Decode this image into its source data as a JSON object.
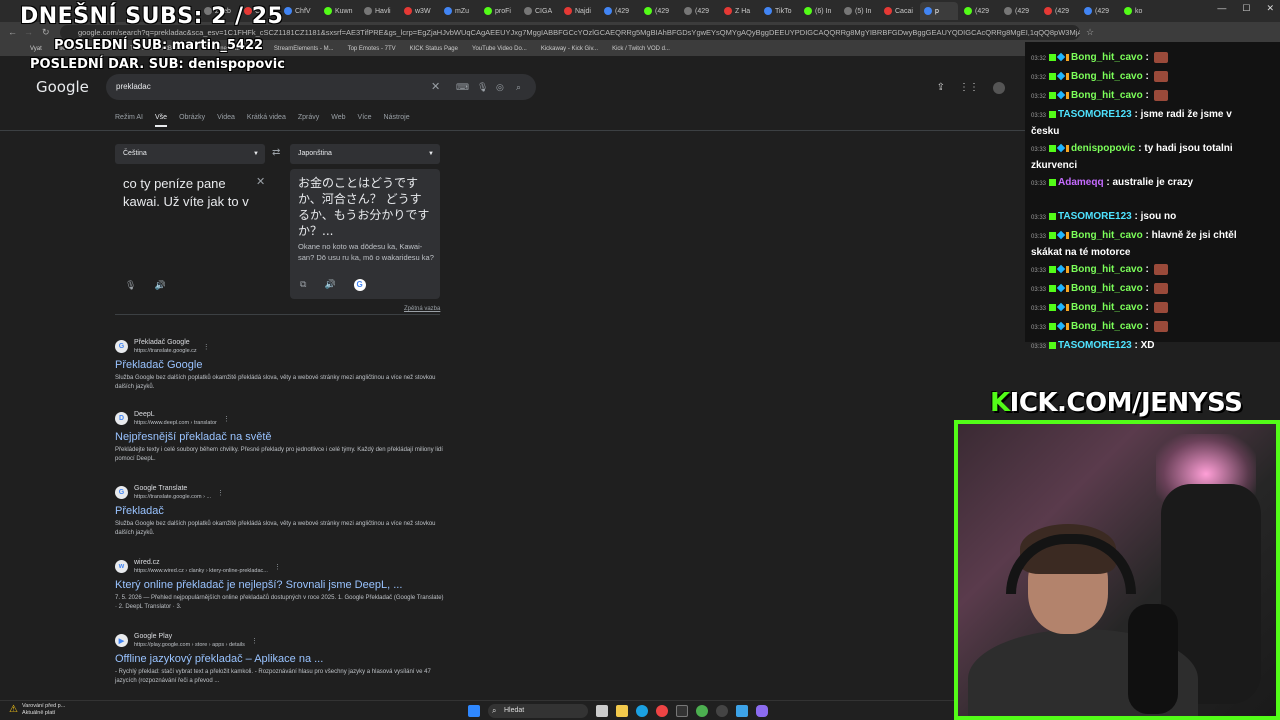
{
  "browser": {
    "tabs": [
      "Zoeb",
      "Čtv",
      "ChfV",
      "Kuwn",
      "Havli",
      "w3W",
      "mZu",
      "proFi",
      "CIGA",
      "Najdi",
      "(429",
      "(429",
      "(429",
      "Z Ha",
      "TikTo",
      "(6) In",
      "(5) In",
      "Cacai",
      "p",
      "(429",
      "(429",
      "(429",
      "(429",
      "ko"
    ],
    "active_tab_index": 18,
    "url": "google.com/search?q=prekladac&sca_esv=1C1FHFk_cSCZ1181CZ1181&sxsrf=AE3TifPRE&gs_lcrp=EgZjaHJvbWUqCAgAEEUYJxg7MggIABBFGCcYOzlGCAEQRRg5MgBIAhBFGDsYgwEYsQMYgAQyBggDEEUYPDIGCAQQRRg8MgYIBRBFGDwyBggGEAUYQDIGCAcQRRg8MgEI,1qQQ8pW3MjAk&sourceid=chrome&ie=UTF-8",
    "bookmarks": [
      "Vyat",
      "File Converter - Free...",
      "The best ChatBot an...",
      "Streamer Dashboard",
      "StreamElements - M...",
      "Top Emotes - 7TV",
      "KICK Status Page",
      "YouTube Video Do...",
      "Kickaway - Kick Giv...",
      "Kick / Twitch VOD d..."
    ]
  },
  "overlay": {
    "subs_line": "DNEŠNÍ SUBS: 2 / 25",
    "last_sub_line": "POSLEDNÍ SUB: martin_5422",
    "last_gift_line": "POSLEDNÍ DAR. SUB: denispopovic"
  },
  "google": {
    "logo": "Google",
    "query": "prekladac",
    "tabs": [
      "Režim AI",
      "Vše",
      "Obrázky",
      "Videa",
      "Krátká videa",
      "Zprávy",
      "Web",
      "Více",
      "Nástroje"
    ],
    "selected_tab": "Vše",
    "translator": {
      "source_lang": "Čeština",
      "target_lang": "Japonština",
      "source_text": "co ty peníze pane kawai. Už víte jak to v",
      "target_text": "お金のことはどうですか、河合さん？ どうするか、もうお分かりですか？...",
      "romanization": "Okane no koto wa dōdesu ka, Kawai-san? Dō usu ru ka, mō o wakaridesu ka?",
      "feedback": "Zpětná vazba"
    },
    "results": [
      {
        "site": "Překladač Google",
        "url": "https://translate.google.cz",
        "title": "Překladač Google",
        "snippet": "Služba Google bez dalších poplatků okamžitě překládá slova, věty a webové stránky mezi angličtinou a více než stovkou dalších jazyků.",
        "icon": "G"
      },
      {
        "site": "DeepL",
        "url": "https://www.deepl.com › translator",
        "title": "Nejpřesnější překladač na světě",
        "snippet": "Překládejte texty i celé soubory během chvilky. Přesné překlady pro jednotlivce i celé týmy. Každý den překládají miliony lidí pomocí DeepL.",
        "icon": "D"
      },
      {
        "site": "Google Translate",
        "url": "https://translate.google.com › ...",
        "title": "Překladač",
        "snippet": "Služba Google bez dalších poplatků okamžitě překládá slova, věty a webové stránky mezi angličtinou a více než stovkou dalších jazyků.",
        "icon": "G"
      },
      {
        "site": "wired.cz",
        "url": "https://www.wired.cz › clanky › ktery-online-prekladac...",
        "title": "Který online překladač je nejlepší? Srovnali jsme DeepL, ...",
        "snippet": "7. 5. 2026 — Přehled nejpopulárnějších online překladačů dostupných v roce 2025. 1. Google Překladač (Google Translate) · 2. DeepL Translator · 3.",
        "icon": "w"
      },
      {
        "site": "Google Play",
        "url": "https://play.google.com › store › apps › details",
        "title": "Offline jazykový překladač – Aplikace na ...",
        "snippet": "- Rychlý překlad: stačí vybrat text a přeložit kamkoli. - Rozpoznávání hlasu pro všechny jazyky a hlasová vysílání ve 47 jazycích (rozpoznávání řeči a převod ...",
        "icon": "▶"
      }
    ]
  },
  "chat": {
    "messages": [
      {
        "time": "03:32",
        "user": "Bong_hit_cavo",
        "text": "",
        "color": "#7cff5a",
        "emote": true
      },
      {
        "time": "03:32",
        "user": "Bong_hit_cavo",
        "text": "",
        "color": "#7cff5a",
        "emote": true
      },
      {
        "time": "03:32",
        "user": "Bong_hit_cavo",
        "text": "",
        "color": "#7cff5a",
        "emote": true
      },
      {
        "time": "03:33",
        "user": "TASOMORE123",
        "text": "jsme radi že jsme v česku",
        "color": "#4fe3ff",
        "emote": false
      },
      {
        "time": "03:33",
        "user": "denispopovic",
        "text": "ty hadi jsou totalni zkurvenci",
        "color": "#7cff5a",
        "emote": false
      },
      {
        "time": "03:33",
        "user": "Adameqq",
        "text": "australie je crazy",
        "color": "#c56bff",
        "emote": false
      },
      {
        "time": "03:33",
        "user": "TASOMORE123",
        "text": "jsou no",
        "color": "#4fe3ff",
        "emote": false
      },
      {
        "time": "03:33",
        "user": "Bong_hit_cavo",
        "text": "hlavně že jsi chtěl skákat na té motorce",
        "color": "#7cff5a",
        "emote": false
      },
      {
        "time": "03:33",
        "user": "Bong_hit_cavo",
        "text": "",
        "color": "#7cff5a",
        "emote": true
      },
      {
        "time": "03:33",
        "user": "Bong_hit_cavo",
        "text": "",
        "color": "#7cff5a",
        "emote": true
      },
      {
        "time": "03:33",
        "user": "Bong_hit_cavo",
        "text": "",
        "color": "#7cff5a",
        "emote": true
      },
      {
        "time": "03:33",
        "user": "Bong_hit_cavo",
        "text": "",
        "color": "#7cff5a",
        "emote": true
      },
      {
        "time": "03:33",
        "user": "TASOMORE123",
        "text": "XD",
        "color": "#4fe3ff",
        "emote": false
      }
    ]
  },
  "kick": {
    "prefix": "K",
    "rest": "ICK.COM/JENYSS"
  },
  "taskbar": {
    "search_label": "Hledat",
    "warning_title": "Varování před p...",
    "warning_sub": "Aktuálně platí"
  }
}
